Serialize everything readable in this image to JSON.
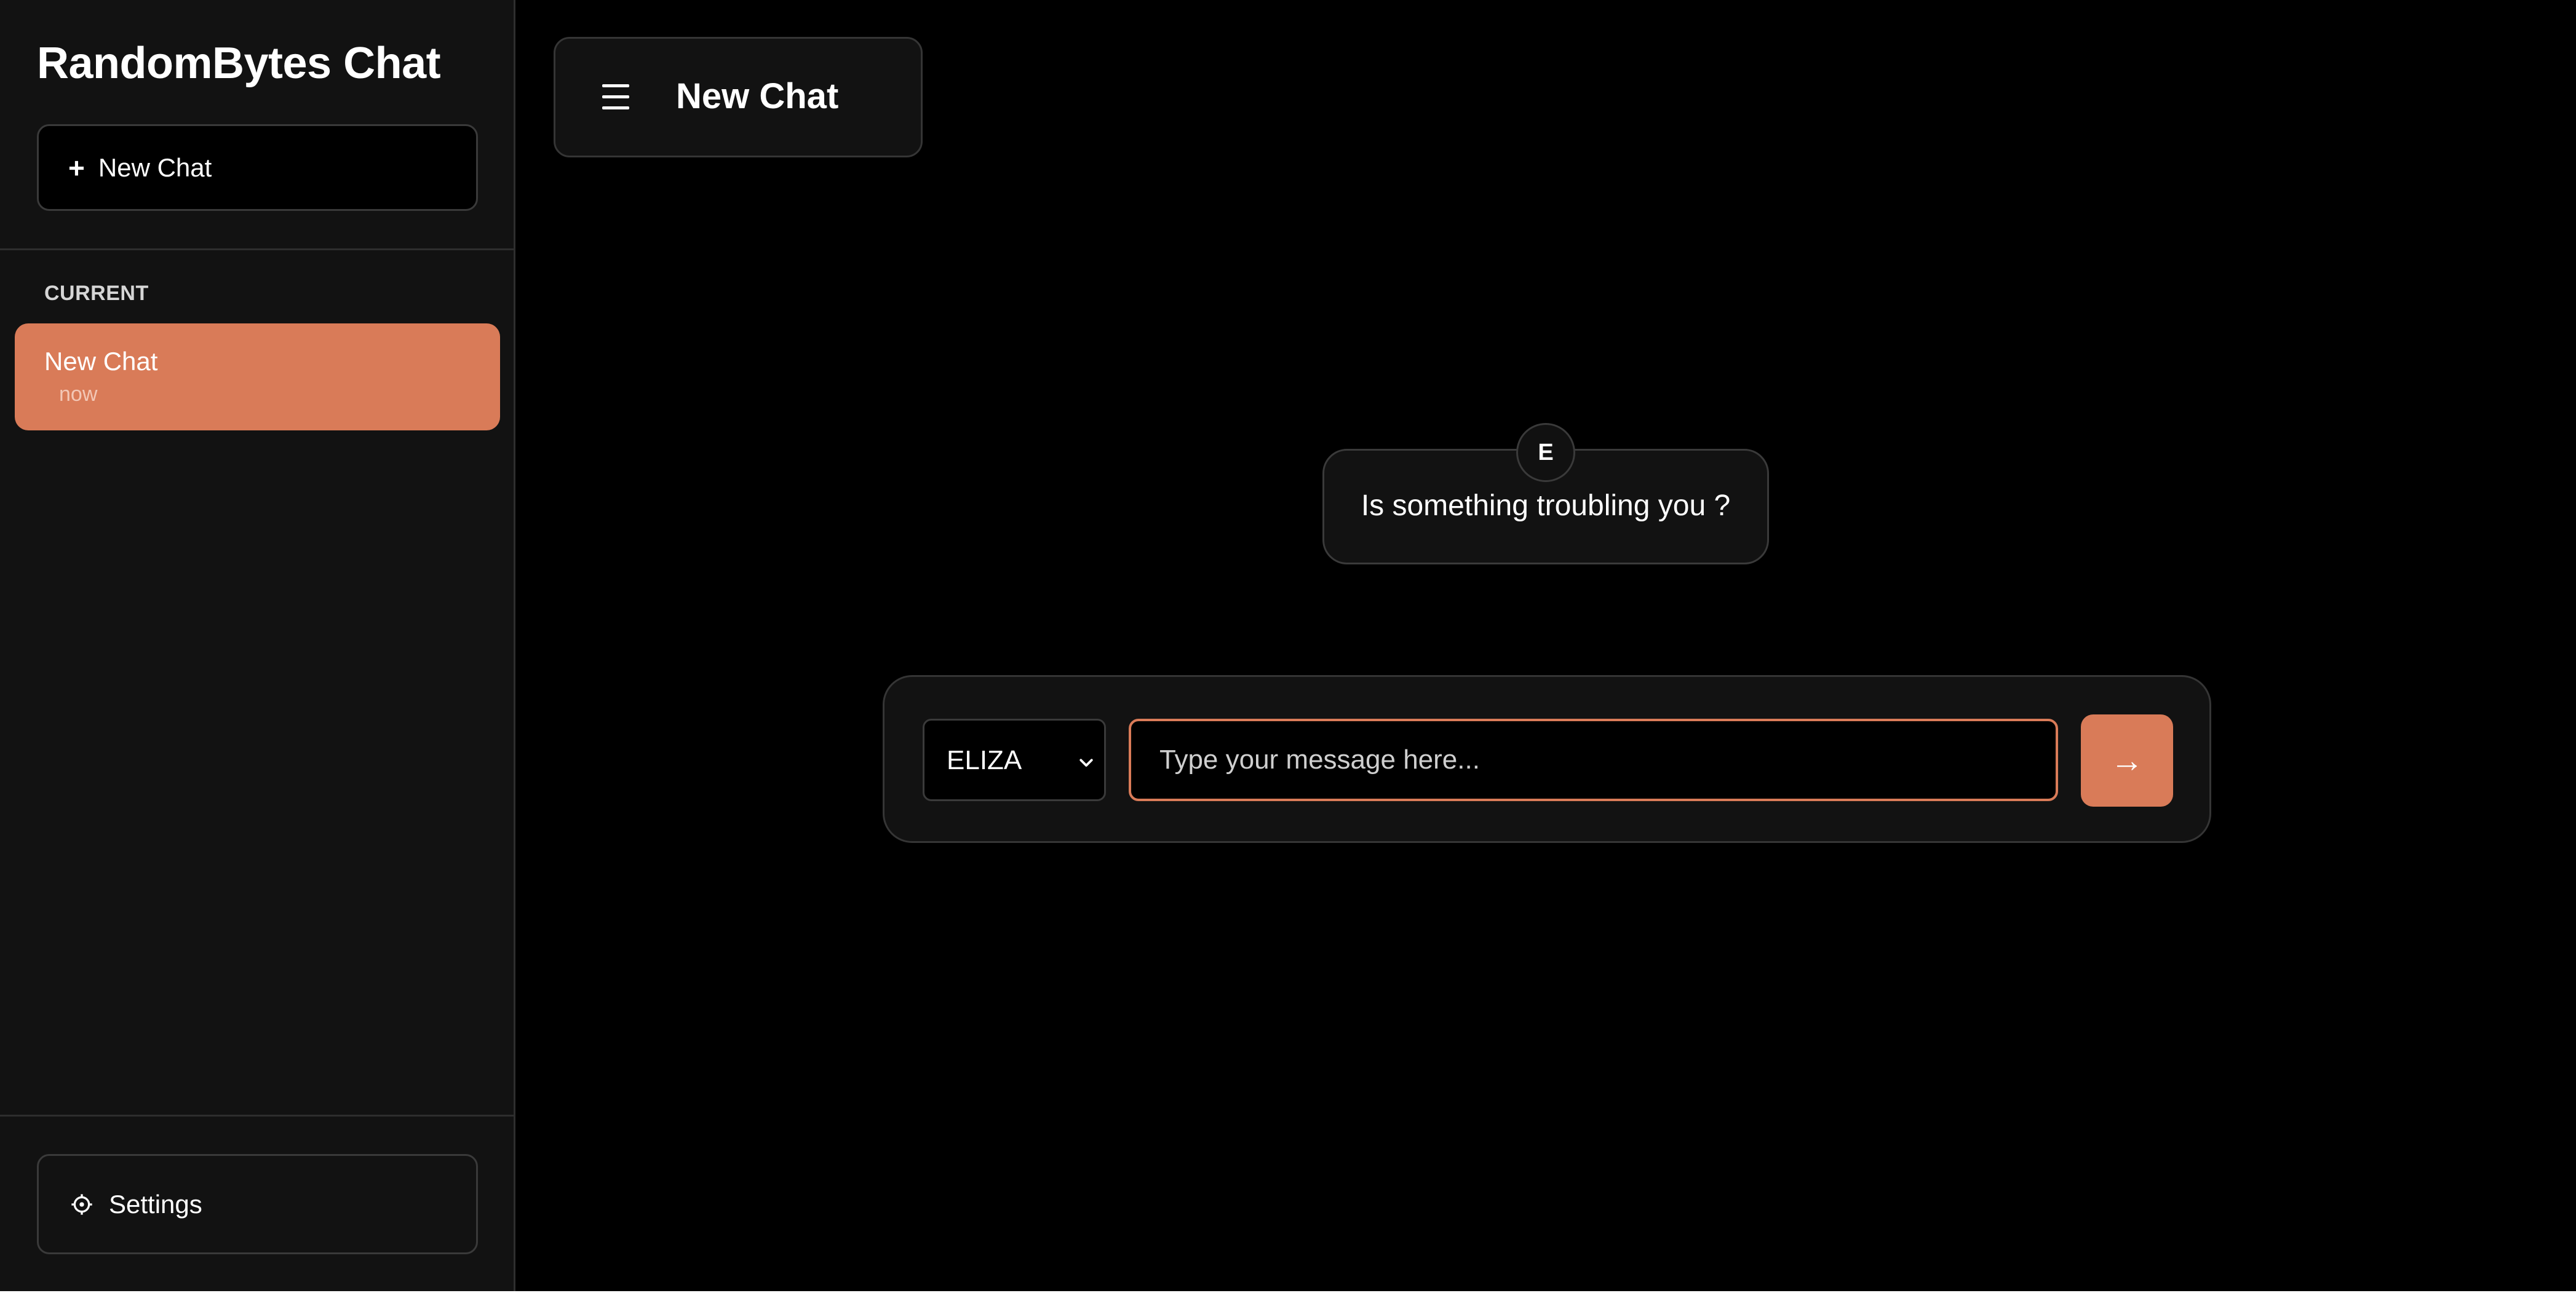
{
  "sidebar": {
    "app_title": "RandomBytes Chat",
    "new_chat_label": "New Chat",
    "section_label": "CURRENT",
    "chats": [
      {
        "title": "New Chat",
        "time": "now",
        "active": true
      }
    ],
    "settings_label": "Settings"
  },
  "header": {
    "title": "New Chat"
  },
  "messages": [
    {
      "sender_initial": "E",
      "text": "Is something troubling you ?"
    }
  ],
  "composer": {
    "selected_model": "ELIZA",
    "placeholder": "Type your message here...",
    "input_value": "",
    "send_glyph": "→"
  },
  "colors": {
    "accent": "#d97b58",
    "background": "#000000",
    "panel": "#121212",
    "border": "#353535"
  },
  "icons": {
    "new_chat": "plus-icon",
    "settings": "gear-icon",
    "menu": "hamburger-menu-icon",
    "select": "chevron-down-icon",
    "send": "arrow-right-icon"
  }
}
